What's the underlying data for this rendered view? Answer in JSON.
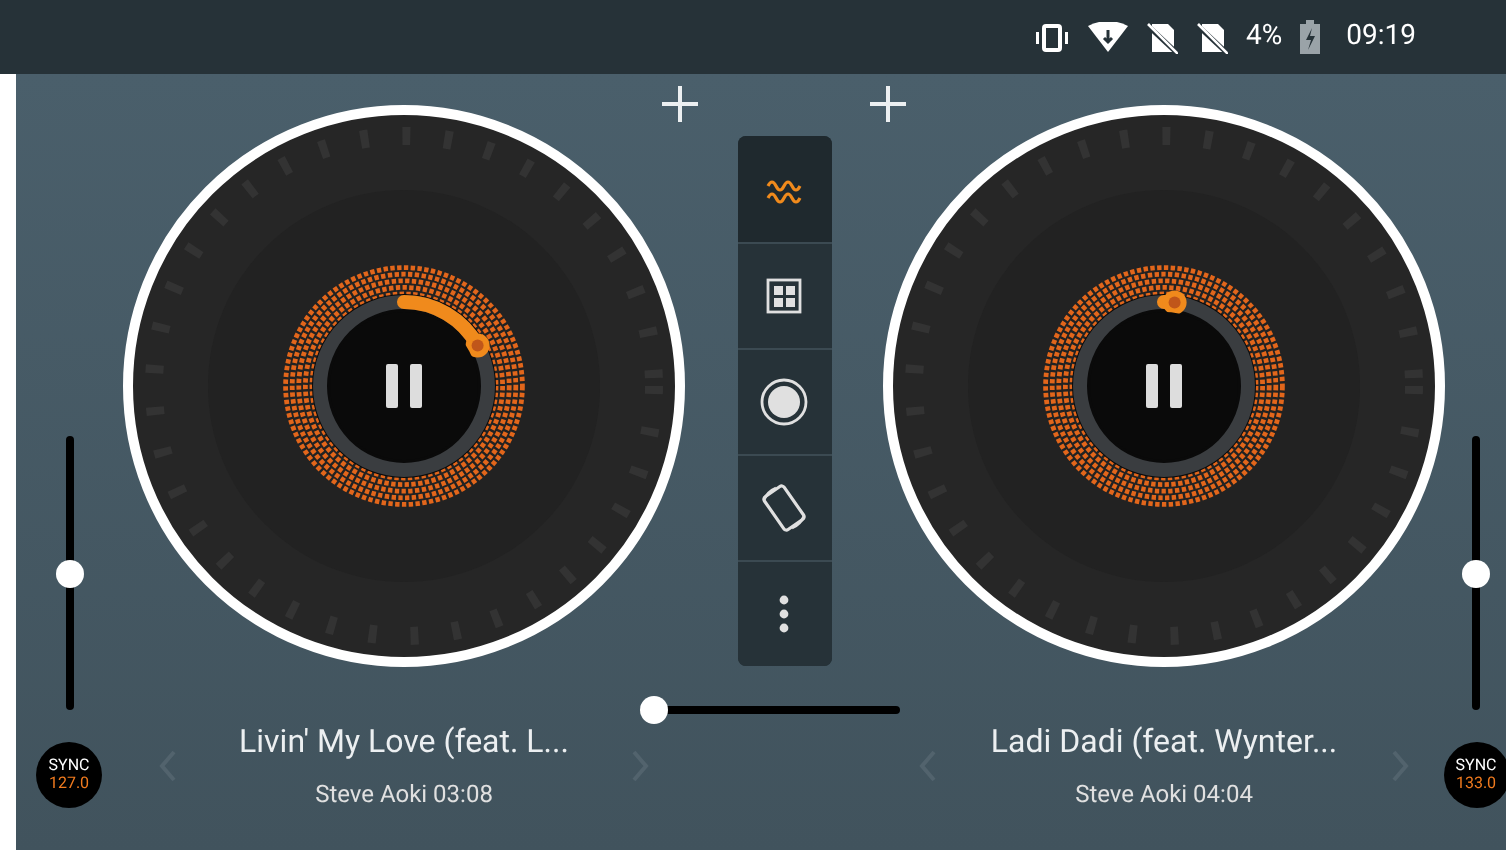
{
  "status_bar": {
    "battery": "4%",
    "time": "09:19"
  },
  "decks": [
    {
      "title": "Livin' My Love (feat. L...",
      "subtitle": "Steve Aoki 03:08",
      "pitch": {
        "level": 0.5
      },
      "sync": {
        "label": "SYNC",
        "bpm": "127.0"
      }
    },
    {
      "title": "Ladi Dadi (feat. Wynter...",
      "subtitle": "Steve Aoki 04:04",
      "pitch": {
        "level": 0.5
      },
      "sync": {
        "label": "SYNC",
        "bpm": "133.0"
      }
    }
  ],
  "toolbar": [
    {
      "kind": "wave",
      "selected": true
    },
    {
      "kind": "grid",
      "selected": false
    },
    {
      "kind": "record",
      "selected": false
    },
    {
      "kind": "rotate",
      "selected": false
    },
    {
      "kind": "more",
      "selected": false
    }
  ],
  "crossfader": {
    "level": 0
  }
}
